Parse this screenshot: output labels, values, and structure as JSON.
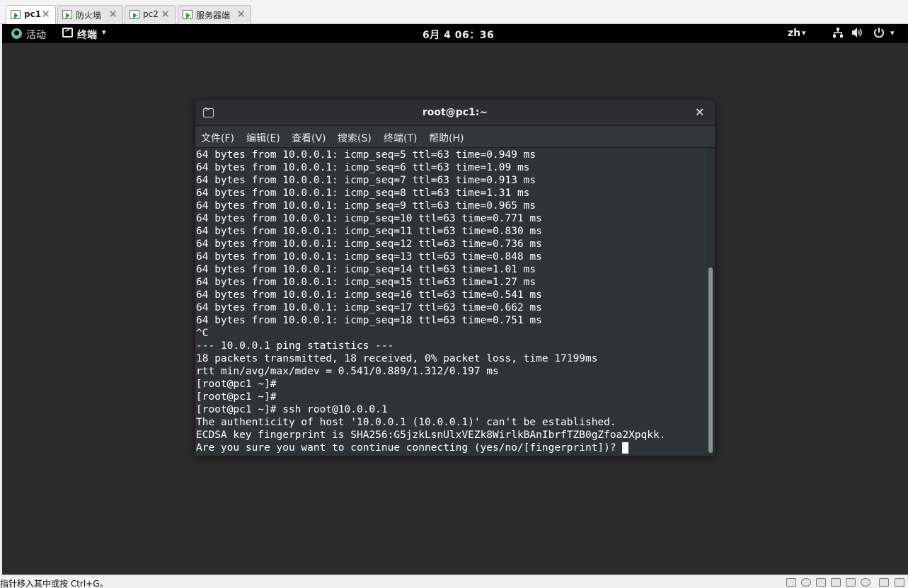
{
  "vm_tabs": [
    {
      "label": "pc1",
      "active": true
    },
    {
      "label": "防火墙",
      "active": false
    },
    {
      "label": "pc2",
      "active": false
    },
    {
      "label": "服务器端",
      "active": false
    }
  ],
  "tab_close_glyph": "✕",
  "topbar": {
    "activities": "活动",
    "app_menu": "终端",
    "caret": "▾",
    "clock": "6月 4  06：36",
    "lang": "zh"
  },
  "terminal": {
    "title": "root@pc1:~",
    "close_glyph": "✕",
    "menu": [
      "文件(F)",
      "编辑(E)",
      "查看(V)",
      "搜索(S)",
      "终端(T)",
      "帮助(H)"
    ],
    "lines": [
      "64 bytes from 10.0.0.1: icmp_seq=5 ttl=63 time=0.949 ms",
      "64 bytes from 10.0.0.1: icmp_seq=6 ttl=63 time=1.09 ms",
      "64 bytes from 10.0.0.1: icmp_seq=7 ttl=63 time=0.913 ms",
      "64 bytes from 10.0.0.1: icmp_seq=8 ttl=63 time=1.31 ms",
      "64 bytes from 10.0.0.1: icmp_seq=9 ttl=63 time=0.965 ms",
      "64 bytes from 10.0.0.1: icmp_seq=10 ttl=63 time=0.771 ms",
      "64 bytes from 10.0.0.1: icmp_seq=11 ttl=63 time=0.830 ms",
      "64 bytes from 10.0.0.1: icmp_seq=12 ttl=63 time=0.736 ms",
      "64 bytes from 10.0.0.1: icmp_seq=13 ttl=63 time=0.848 ms",
      "64 bytes from 10.0.0.1: icmp_seq=14 ttl=63 time=1.01 ms",
      "64 bytes from 10.0.0.1: icmp_seq=15 ttl=63 time=1.27 ms",
      "64 bytes from 10.0.0.1: icmp_seq=16 ttl=63 time=0.541 ms",
      "64 bytes from 10.0.0.1: icmp_seq=17 ttl=63 time=0.662 ms",
      "64 bytes from 10.0.0.1: icmp_seq=18 ttl=63 time=0.751 ms",
      "^C",
      "--- 10.0.0.1 ping statistics ---",
      "18 packets transmitted, 18 received, 0% packet loss, time 17199ms",
      "rtt min/avg/max/mdev = 0.541/0.889/1.312/0.197 ms",
      "[root@pc1 ~]#",
      "[root@pc1 ~]#",
      "[root@pc1 ~]# ssh root@10.0.0.1",
      "The authenticity of host '10.0.0.1 (10.0.0.1)' can't be established.",
      "ECDSA key fingerprint is SHA256:G5jzkLsnUlxVEZk8WirlkBAnIbrfTZB0gZfoa2Xpqkk.",
      "Are you sure you want to continue connecting (yes/no/[fingerprint])? "
    ]
  },
  "statusbar": {
    "text": "指针移入其中或按 Ctrl+G。"
  },
  "colors": {
    "terminal_bg": "#2e3436",
    "terminal_fg": "#ffffff",
    "topbar_bg": "#000000",
    "desktop_bg": "#2b2b2b"
  }
}
